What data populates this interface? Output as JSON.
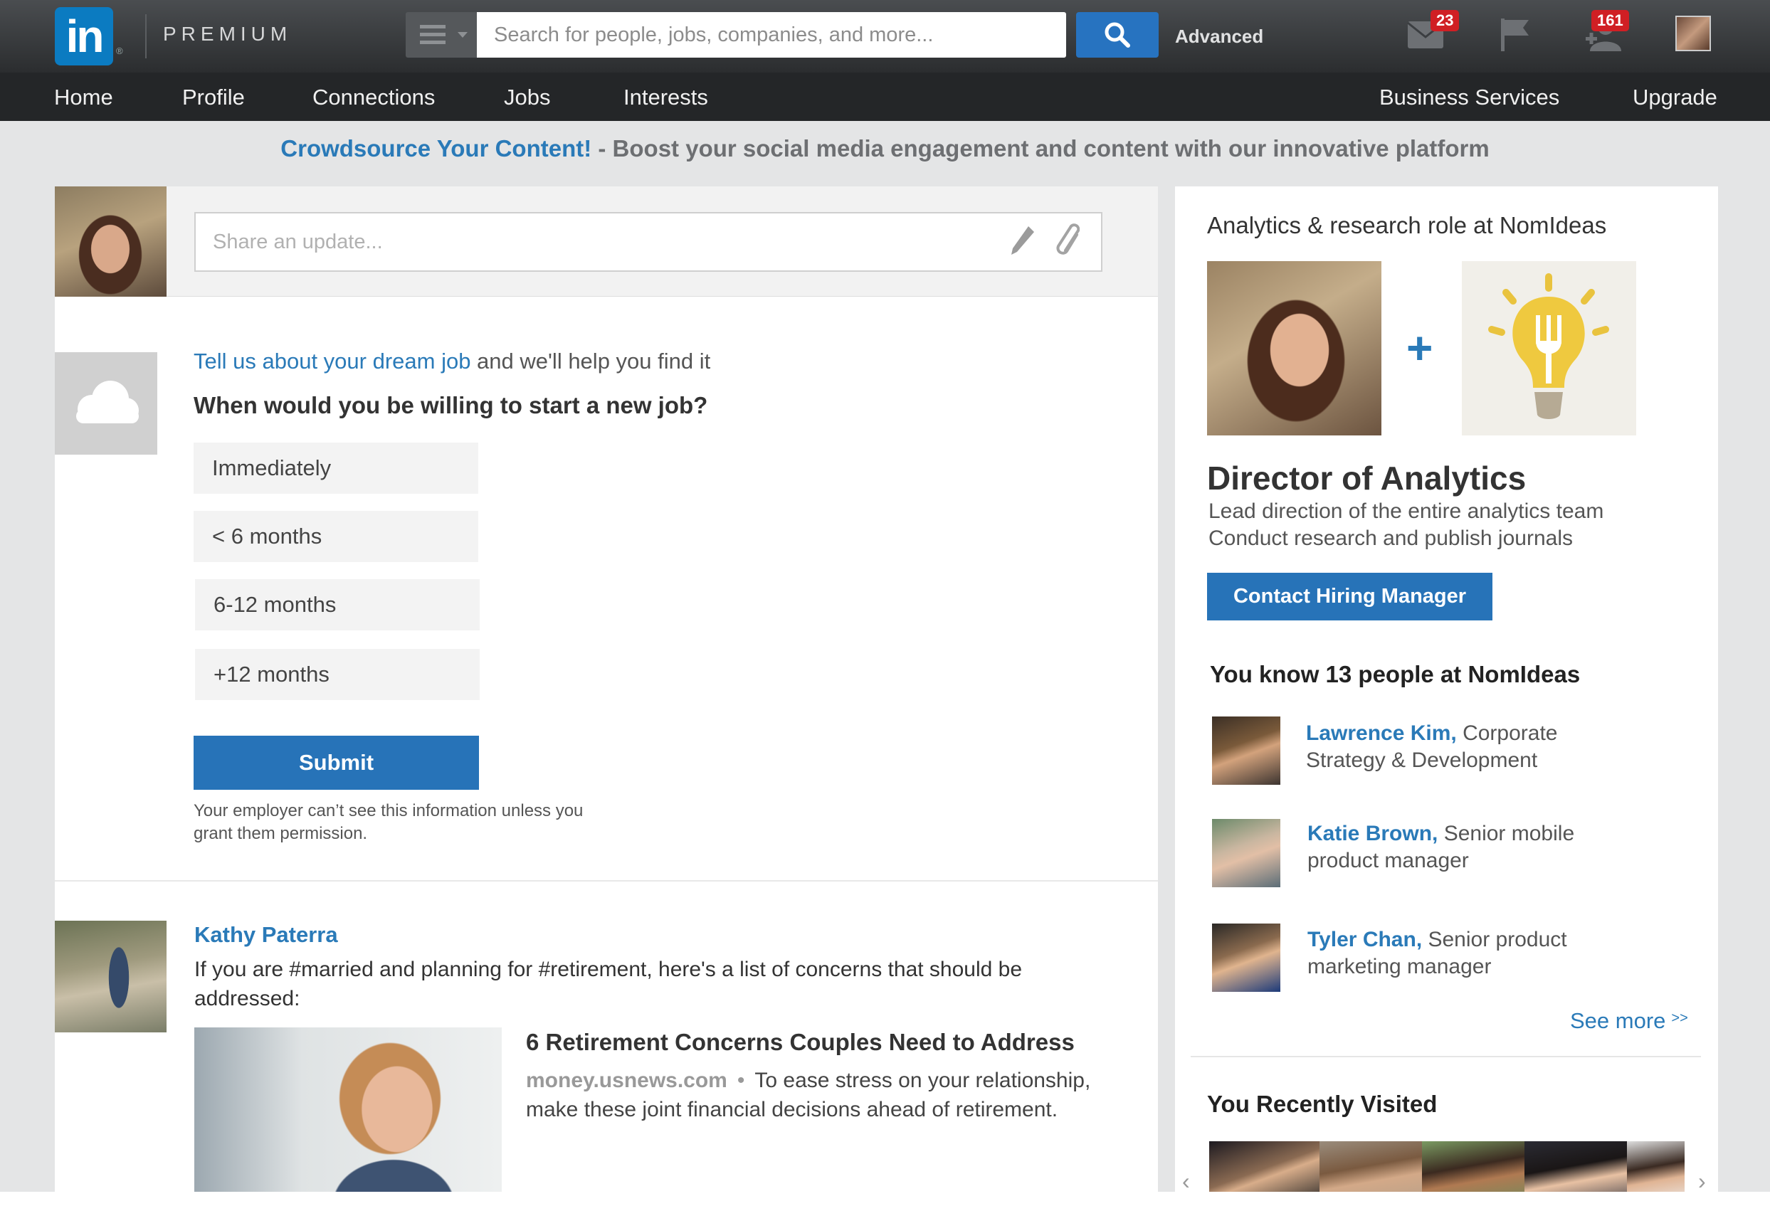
{
  "header": {
    "logo_text": "in",
    "brand_label": "PREMIUM",
    "search_placeholder": "Search for people, jobs, companies, and more...",
    "advanced_label": "Advanced",
    "messages_count": "23",
    "notifications_count": "161"
  },
  "nav": {
    "items": [
      "Home",
      "Profile",
      "Connections",
      "Jobs",
      "Interests"
    ],
    "right_items": [
      "Business Services",
      "Upgrade"
    ]
  },
  "promo": {
    "link": "Crowdsource Your Content!",
    "text": " - Boost your social media engagement and content with our innovative platform"
  },
  "share": {
    "placeholder": "Share an update..."
  },
  "dream_job": {
    "link": "Tell us about your dream job",
    "rest": " and we'll help you find it",
    "question": "When would you be willing to start a new job?",
    "options": [
      "Immediately",
      "< 6 months",
      "6-12 months",
      "+12 months"
    ],
    "submit_label": "Submit",
    "disclaimer": "Your employer can’t see this information unless you grant them permission."
  },
  "post": {
    "author": "Kathy Paterra",
    "text": "If you are #married and planning for #retirement, here's a list of concerns that should be addressed:",
    "article_title": "6 Retirement Concerns Couples Need to Address",
    "article_source": "money.usnews.com",
    "article_desc": "To ease stress on your relationship, make these joint financial decisions ahead of retirement."
  },
  "ad": {
    "heading": "Analytics & research role at NomIdeas",
    "plus": "+",
    "title": "Director of Analytics",
    "desc_line1": "Lead direction of the entire analytics team",
    "desc_line2": "Conduct research and publish journals",
    "button_label": "Contact Hiring Manager"
  },
  "connections": {
    "heading": "You know 13 people at NomIdeas",
    "people": [
      {
        "name": "Lawrence Kim,",
        "role": " Corporate Strategy & Development"
      },
      {
        "name": "Katie Brown,",
        "role": " Senior mobile product manager"
      },
      {
        "name": "Tyler Chan,",
        "role": " Senior product marketing manager"
      }
    ],
    "see_more": "See more",
    "see_more_arrow": ">>"
  },
  "recent": {
    "heading": "You Recently Visited"
  },
  "colors": {
    "accent_blue": "#2773b8",
    "link_blue": "#2a7ab8",
    "badge_red": "#d01f24"
  }
}
